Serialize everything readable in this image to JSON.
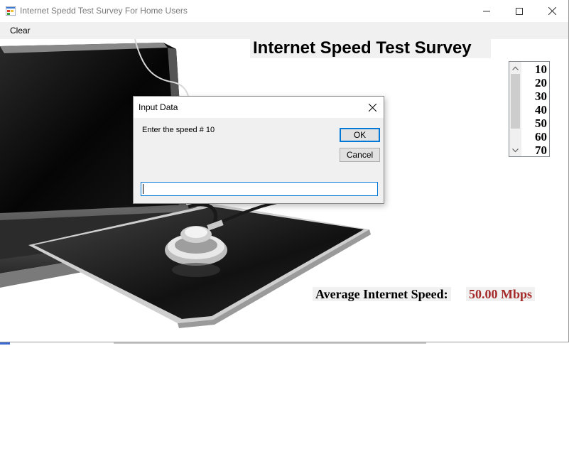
{
  "window": {
    "title": "Internet Spedd Test Survey For Home Users",
    "minimize_icon": "minimize-icon",
    "maximize_icon": "maximize-icon",
    "close_icon": "close-icon"
  },
  "menu": {
    "clear_label": "Clear"
  },
  "main": {
    "heading": "Internet Speed Test Survey",
    "speed_list": [
      "10",
      "20",
      "30",
      "40",
      "50",
      "60",
      "70"
    ],
    "average_label": "Average Internet Speed:",
    "average_value": "50.00 Mbps"
  },
  "dialog": {
    "title": "Input Data",
    "prompt": "Enter the speed # 10",
    "ok_label": "OK",
    "cancel_label": "Cancel",
    "input_value": ""
  },
  "colors": {
    "accent": "#0078d7",
    "average_value": "#a52a2a",
    "label_background": "#f1f1f1"
  }
}
